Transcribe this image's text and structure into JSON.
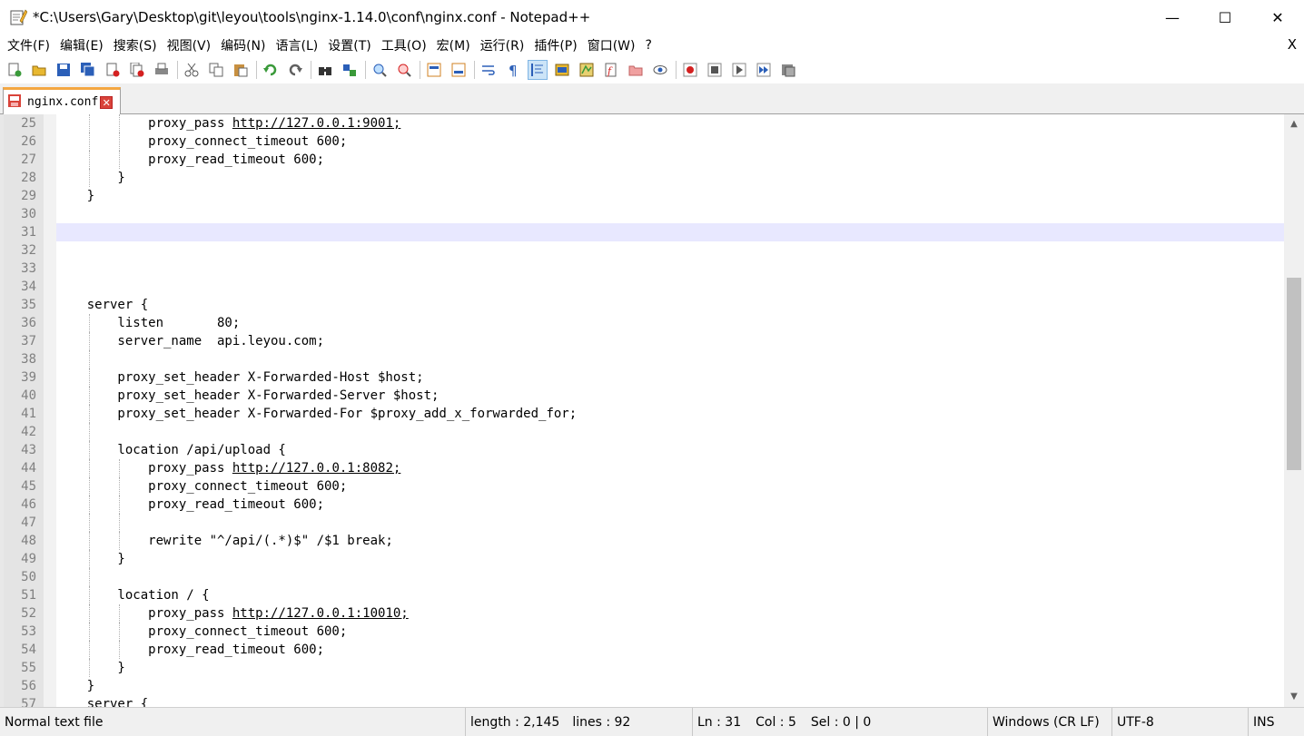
{
  "window": {
    "title": "*C:\\Users\\Gary\\Desktop\\git\\leyou\\tools\\nginx-1.14.0\\conf\\nginx.conf - Notepad++",
    "minimize_glyph": "—",
    "maximize_glyph": "☐",
    "close_glyph": "✕"
  },
  "menu": {
    "items": [
      "文件(F)",
      "编辑(E)",
      "搜索(S)",
      "视图(V)",
      "编码(N)",
      "语言(L)",
      "设置(T)",
      "工具(O)",
      "宏(M)",
      "运行(R)",
      "插件(P)",
      "窗口(W)",
      "?"
    ],
    "close_glyph": "X"
  },
  "toolbar": {
    "buttons": [
      "new-file-icon",
      "open-file-icon",
      "save-icon",
      "save-all-icon",
      "close-icon",
      "close-all-icon",
      "print-icon",
      "cut-icon",
      "copy-icon",
      "paste-icon",
      "undo-icon",
      "redo-icon",
      "find-icon",
      "replace-icon",
      "zoom-in-icon",
      "zoom-out-icon",
      "sync-vertical-icon",
      "sync-horizontal-icon",
      "word-wrap-icon",
      "show-all-chars-icon",
      "indent-guide-icon",
      "language-icon",
      "doc-map-icon",
      "function-list-icon",
      "folder-workspace-icon",
      "monitoring-icon",
      "record-macro-icon",
      "stop-record-icon",
      "play-macro-icon",
      "run-macro-multiple-icon",
      "save-macro-icon"
    ],
    "colors": {
      "green": "#3a9a3a",
      "blue": "#2b5fb8",
      "red": "#d42020",
      "yellow": "#e8b830"
    }
  },
  "tab": {
    "label": "nginx.conf",
    "close_glyph": "✕"
  },
  "editor": {
    "current_line": 31,
    "lines": [
      {
        "n": "25",
        "text": "            proxy_pass ",
        "url": "http://127.0.0.1:9001;",
        "guides": [
          1,
          2
        ]
      },
      {
        "n": "26",
        "text": "            proxy_connect_timeout 600;",
        "guides": [
          1,
          2
        ]
      },
      {
        "n": "27",
        "text": "            proxy_read_timeout 600;",
        "guides": [
          1,
          2
        ]
      },
      {
        "n": "28",
        "text": "        }",
        "guides": [
          1
        ]
      },
      {
        "n": "29",
        "text": "    }",
        "guides": []
      },
      {
        "n": "30",
        "text": "",
        "guides": []
      },
      {
        "n": "31",
        "text": "",
        "guides": []
      },
      {
        "n": "32",
        "text": "",
        "guides": []
      },
      {
        "n": "33",
        "text": "",
        "guides": []
      },
      {
        "n": "34",
        "text": "",
        "guides": []
      },
      {
        "n": "35",
        "text": "    server {",
        "guides": []
      },
      {
        "n": "36",
        "text": "        listen       80;",
        "guides": [
          1
        ]
      },
      {
        "n": "37",
        "text": "        server_name  api.leyou.com;",
        "guides": [
          1
        ]
      },
      {
        "n": "38",
        "text": "",
        "guides": [
          1
        ]
      },
      {
        "n": "39",
        "text": "        proxy_set_header X-Forwarded-Host $host;",
        "guides": [
          1
        ]
      },
      {
        "n": "40",
        "text": "        proxy_set_header X-Forwarded-Server $host;",
        "guides": [
          1
        ]
      },
      {
        "n": "41",
        "text": "        proxy_set_header X-Forwarded-For $proxy_add_x_forwarded_for;",
        "guides": [
          1
        ]
      },
      {
        "n": "42",
        "text": "",
        "guides": [
          1
        ]
      },
      {
        "n": "43",
        "text": "        location /api/upload {",
        "guides": [
          1
        ]
      },
      {
        "n": "44",
        "text": "            proxy_pass ",
        "url": "http://127.0.0.1:8082;",
        "guides": [
          1,
          2
        ]
      },
      {
        "n": "45",
        "text": "            proxy_connect_timeout 600;",
        "guides": [
          1,
          2
        ]
      },
      {
        "n": "46",
        "text": "            proxy_read_timeout 600;",
        "guides": [
          1,
          2
        ]
      },
      {
        "n": "47",
        "text": "",
        "guides": [
          1,
          2
        ]
      },
      {
        "n": "48",
        "text": "            rewrite \"^/api/(.*)$\" /$1 break;",
        "guides": [
          1,
          2
        ]
      },
      {
        "n": "49",
        "text": "        }",
        "guides": [
          1
        ]
      },
      {
        "n": "50",
        "text": "",
        "guides": [
          1
        ]
      },
      {
        "n": "51",
        "text": "        location / {",
        "guides": [
          1
        ]
      },
      {
        "n": "52",
        "text": "            proxy_pass ",
        "url": "http://127.0.0.1:10010;",
        "guides": [
          1,
          2
        ]
      },
      {
        "n": "53",
        "text": "            proxy_connect_timeout 600;",
        "guides": [
          1,
          2
        ]
      },
      {
        "n": "54",
        "text": "            proxy_read_timeout 600;",
        "guides": [
          1,
          2
        ]
      },
      {
        "n": "55",
        "text": "        }",
        "guides": [
          1
        ]
      },
      {
        "n": "56",
        "text": "    }",
        "guides": []
      },
      {
        "n": "57",
        "text": "    server {",
        "guides": []
      }
    ],
    "scroll_up_glyph": "▲",
    "scroll_down_glyph": "▼"
  },
  "status": {
    "file_type": "Normal text file",
    "length": "length : 2,145",
    "lines": "lines : 92",
    "ln": "Ln : 31",
    "col": "Col : 5",
    "sel": "Sel : 0 | 0",
    "eol": "Windows (CR LF)",
    "encoding": "UTF-8",
    "mode": "INS"
  }
}
